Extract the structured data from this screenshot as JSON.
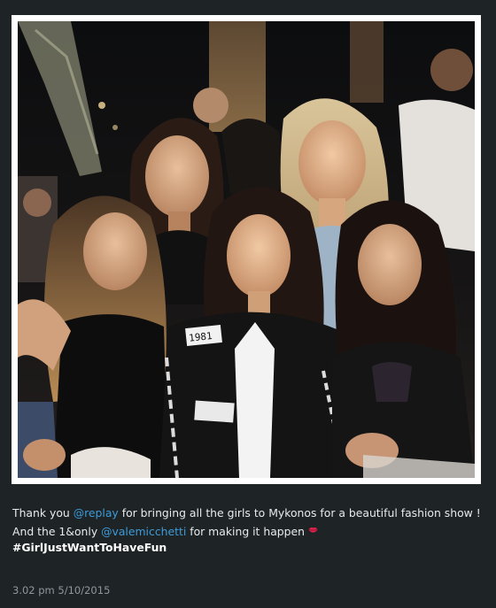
{
  "post": {
    "photo": {
      "alt_icon": "photo-of-five-women-at-night-party"
    },
    "caption": {
      "part1": "Thank you ",
      "mention1": "@replay",
      "part2": " for bringing all the girls to Mykonos for a beautiful fashion show ! And the 1&only ",
      "mention2": "@valemicchetti",
      "part3": " for making it happen",
      "emoji_icon": "lips-kiss-icon",
      "hashtag": "#GirlJustWantToHaveFun"
    },
    "timestamp": "3.02 pm 5/10/2015",
    "jacket_patch": "1981"
  },
  "colors": {
    "background": "#1e2326",
    "mention": "#3e9bd8",
    "text": "#e7eaec",
    "timestamp": "#8f979c"
  }
}
